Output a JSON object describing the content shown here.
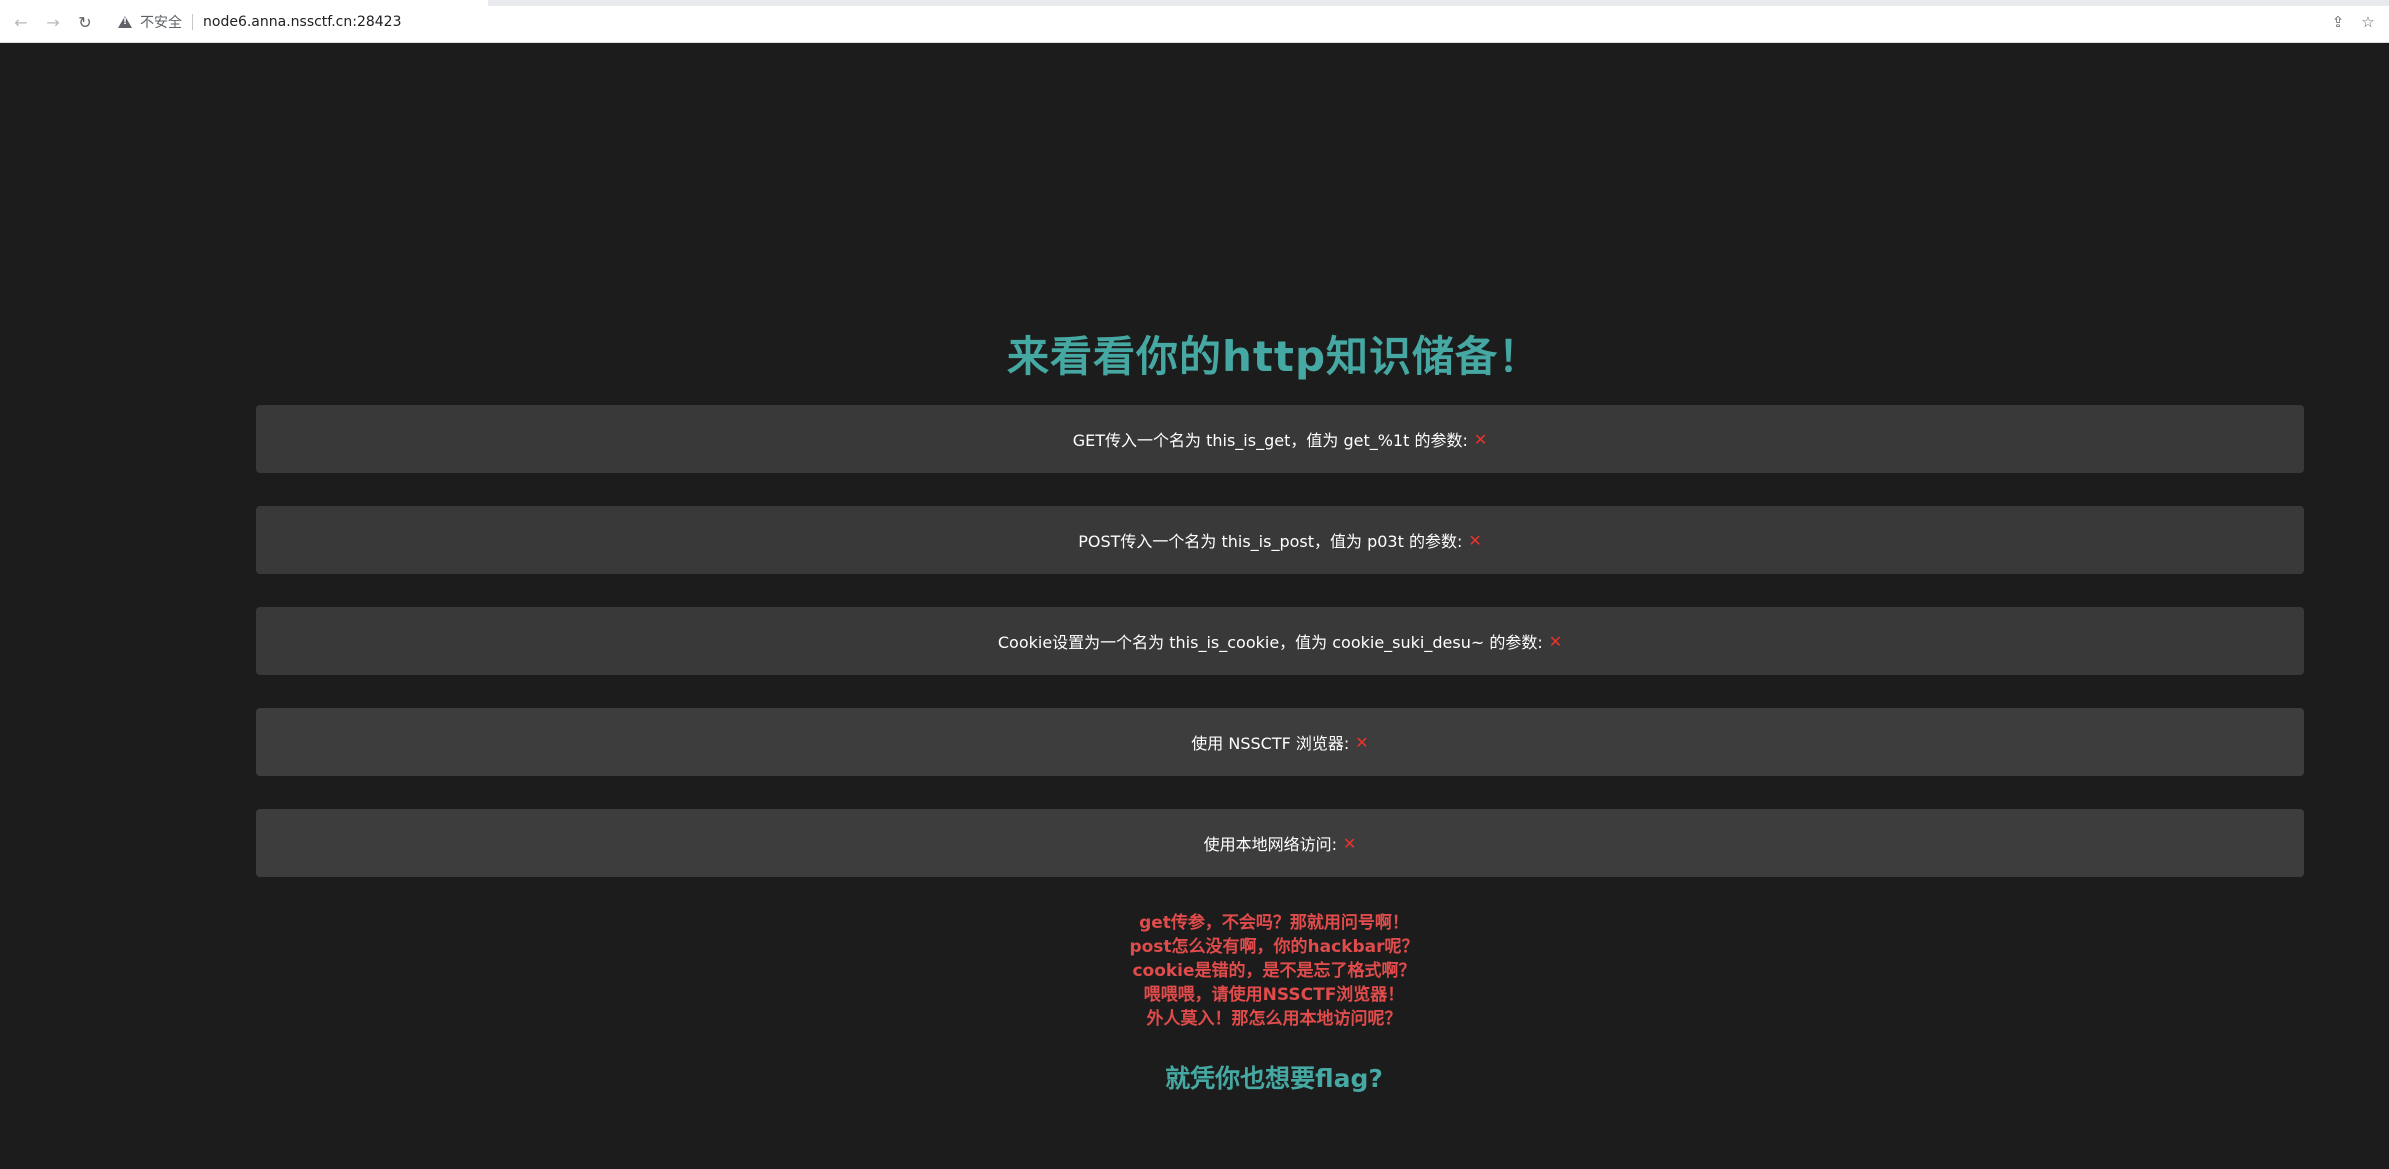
{
  "browser": {
    "security_label": "不安全",
    "url": "node6.anna.nssctf.cn:28423",
    "icons": {
      "back": "arrow-left-icon",
      "forward": "arrow-right-icon",
      "reload": "reload-icon",
      "warning": "warning-triangle-icon",
      "share": "share-icon",
      "bookmark": "star-icon"
    }
  },
  "page": {
    "heading": "来看看你的http知识储备！",
    "tasks": [
      {
        "text": "GET传入一个名为 this_is_get，值为 get_%1t 的参数:",
        "status": "✕"
      },
      {
        "text": "POST传入一个名为 this_is_post，值为 p03t 的参数:",
        "status": "✕"
      },
      {
        "text": "Cookie设置为一个名为 this_is_cookie，值为 cookie_suki_desu~ 的参数:",
        "status": "✕"
      },
      {
        "text": "使用 NSSCTF 浏览器:",
        "status": "✕"
      },
      {
        "text": "使用本地网络访问:",
        "status": "✕"
      }
    ],
    "hints": [
      "get传参，不会吗？那就用问号啊！",
      "post怎么没有啊，你的hackbar呢？",
      "cookie是错的，是不是忘了格式啊？",
      "喂喂喂，请使用NSSCTF浏览器！",
      "外人莫入！那怎么用本地访问呢？"
    ],
    "footer_question": "就凭你也想要flag?"
  },
  "colors": {
    "background": "#1c1c1c",
    "heading": "#45a8a2",
    "task_bg": "#393939",
    "fail_mark": "#e8332b",
    "hint": "#e04b4b"
  }
}
